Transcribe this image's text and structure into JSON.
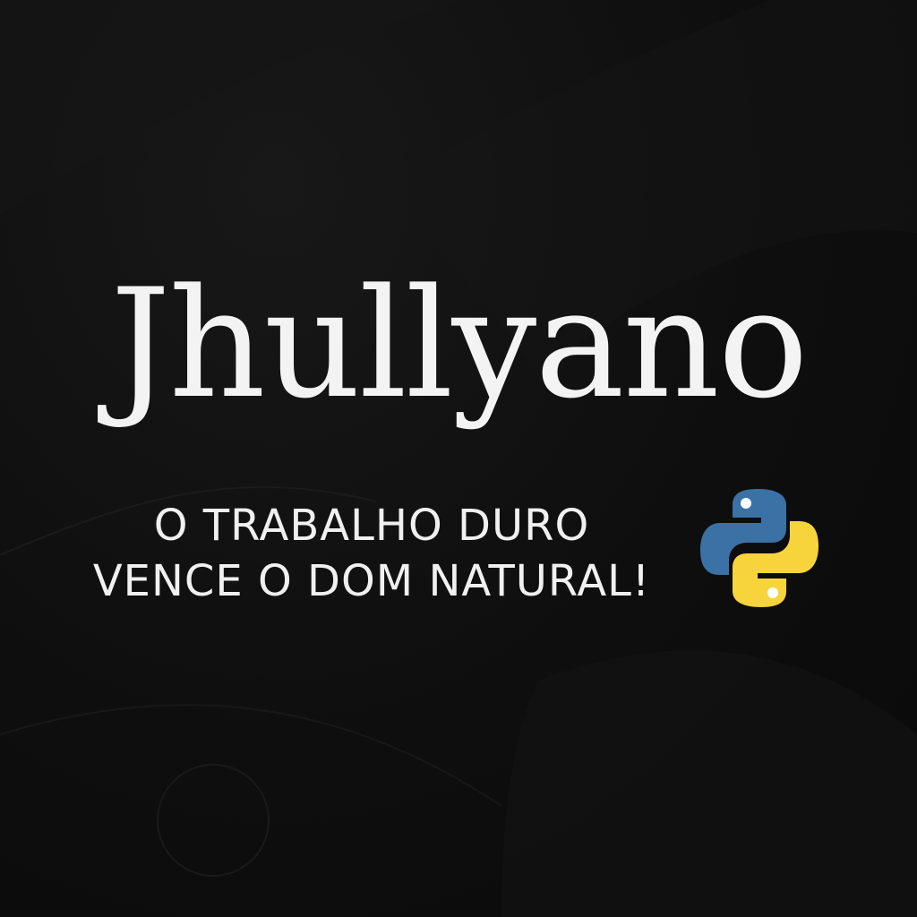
{
  "title": "Jhullyano",
  "tagline": {
    "line1": "O TRABALHO DURO",
    "line2": "VENCE O DOM NATURAL!"
  },
  "logo": {
    "icon": "python-logo-icon",
    "colors": {
      "blue": "#3a72a6",
      "yellow": "#f7d43c"
    }
  },
  "colors": {
    "background": "#0d0d0d",
    "text": "#f3f3f3"
  }
}
